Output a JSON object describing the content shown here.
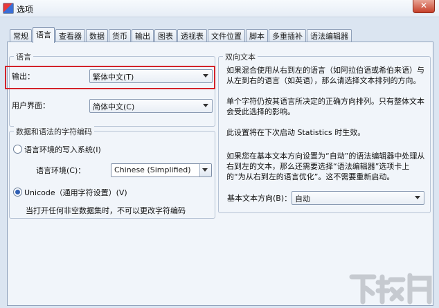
{
  "window": {
    "title": "选项",
    "close_glyph": "✕"
  },
  "tabs": [
    {
      "label": "常规",
      "active": false
    },
    {
      "label": "语言",
      "active": true
    },
    {
      "label": "查看器",
      "active": false
    },
    {
      "label": "数据",
      "active": false
    },
    {
      "label": "货币",
      "active": false
    },
    {
      "label": "输出",
      "active": false
    },
    {
      "label": "图表",
      "active": false
    },
    {
      "label": "透视表",
      "active": false
    },
    {
      "label": "文件位置",
      "active": false
    },
    {
      "label": "脚本",
      "active": false
    },
    {
      "label": "多重插补",
      "active": false
    },
    {
      "label": "语法编辑器",
      "active": false
    }
  ],
  "language_group": {
    "title": "语言",
    "output_label": "输出：",
    "output_value": "繁体中文(T)",
    "ui_label": "用户界面：",
    "ui_value": "简体中文(C)"
  },
  "encoding_group": {
    "title": "数据和语法的字符编码",
    "locale_option": "语言环境的写入系统(I)",
    "locale_label": "语言环境(C)：",
    "locale_value": "Chinese (Simplified)",
    "unicode_option": "Unicode（通用字符设置）(V)",
    "note": "当打开任何非空数据集时，不可以更改字符编码"
  },
  "bidi_group": {
    "title": "双向文本",
    "p1": "如果混合使用从右到左的语言（如阿拉伯语或希伯来语）与从左到右的语言（如英语），那么请选择文本排列的方向。",
    "p2": "单个字符仍按其语言所决定的正确方向排列。只有整体文本会受此选择的影响。",
    "p3": "此设置将在下次启动 Statistics 时生效。",
    "p4": "如果您在基本文本方向设置为“自动”的语法编辑器中处理从右到左的文本，那么还需要选择“语法编辑器”选项卡上的“为从右到左的语言优化”。这不需要重新启动。",
    "base_dir_label": "基本文本方向(B)：",
    "base_dir_value": "自动"
  },
  "watermark": {
    "text": "下载吧"
  },
  "colors": {
    "highlight": "#d3232a",
    "panel": "#f1f5fa",
    "frame": "#dbe5f1"
  }
}
